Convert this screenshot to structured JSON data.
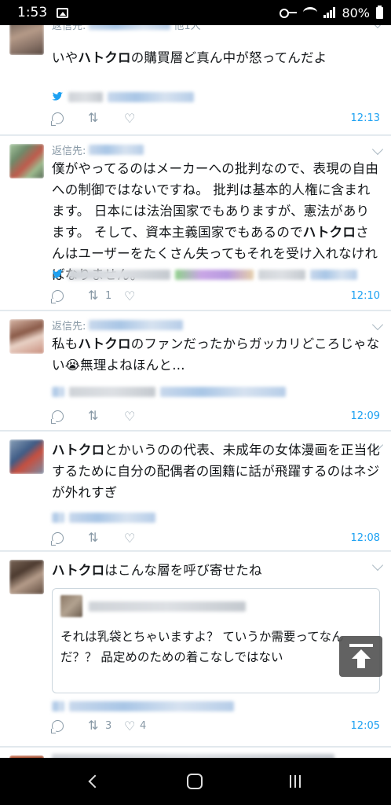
{
  "status_bar": {
    "time": "1:53",
    "battery": "80%"
  },
  "tweets": [
    {
      "reply_label": "返信先:",
      "reply_suffix": "他1人",
      "segments": [
        "いや",
        "ハトクロ",
        "の購買層ど真ん中が怒ってんだよ"
      ],
      "timestamp": "12:13",
      "retweet_count": "",
      "like_count": ""
    },
    {
      "reply_label": "返信先:",
      "segments": [
        "僕がやってるのはメーカーへの批判なので、表現の自由への制御ではないですね。 批判は基本的人権に含まれます。 日本には法治国家でもありますが、憲法があります。 そして、資本主義国家でもあるので",
        "ハトクロ",
        "さんはユーザーをたくさん失ってもそれを受け入れなければなりません。"
      ],
      "timestamp": "12:10",
      "retweet_count": "1",
      "like_count": ""
    },
    {
      "reply_label": "返信先:",
      "segments": [
        "私も",
        "ハトクロ",
        "のファンだったからガッカリどころじゃない😭無理よねほんと…"
      ],
      "timestamp": "12:09",
      "retweet_count": "",
      "like_count": ""
    },
    {
      "segments": [
        "",
        "ハトクロ",
        "とかいうのの代表、未成年の女体漫画を正当化するために自分の配偶者の国籍に話が飛躍するのはネジが外れすぎ"
      ],
      "timestamp": "12:08",
      "retweet_count": "",
      "like_count": ""
    },
    {
      "segments": [
        "",
        "ハトクロ",
        "はこんな層を呼び寄せたね"
      ],
      "quote_text": "それは乳袋とちゃいますよ？ ていうか需要ってなんだ？？ 品定めのための着こなしではない",
      "timestamp": "12:05",
      "retweet_count": "3",
      "like_count": "4"
    }
  ],
  "icons": {
    "reply": "reply-icon",
    "retweet": "retweet-icon",
    "like": "heart-icon",
    "source": "twitter-bird-icon",
    "scroll_top": "arrow-up-to-top-icon"
  },
  "colors": {
    "accent": "#1da1f2",
    "muted": "#8899a6",
    "text": "#14171a",
    "background": "#e6ecf0"
  }
}
